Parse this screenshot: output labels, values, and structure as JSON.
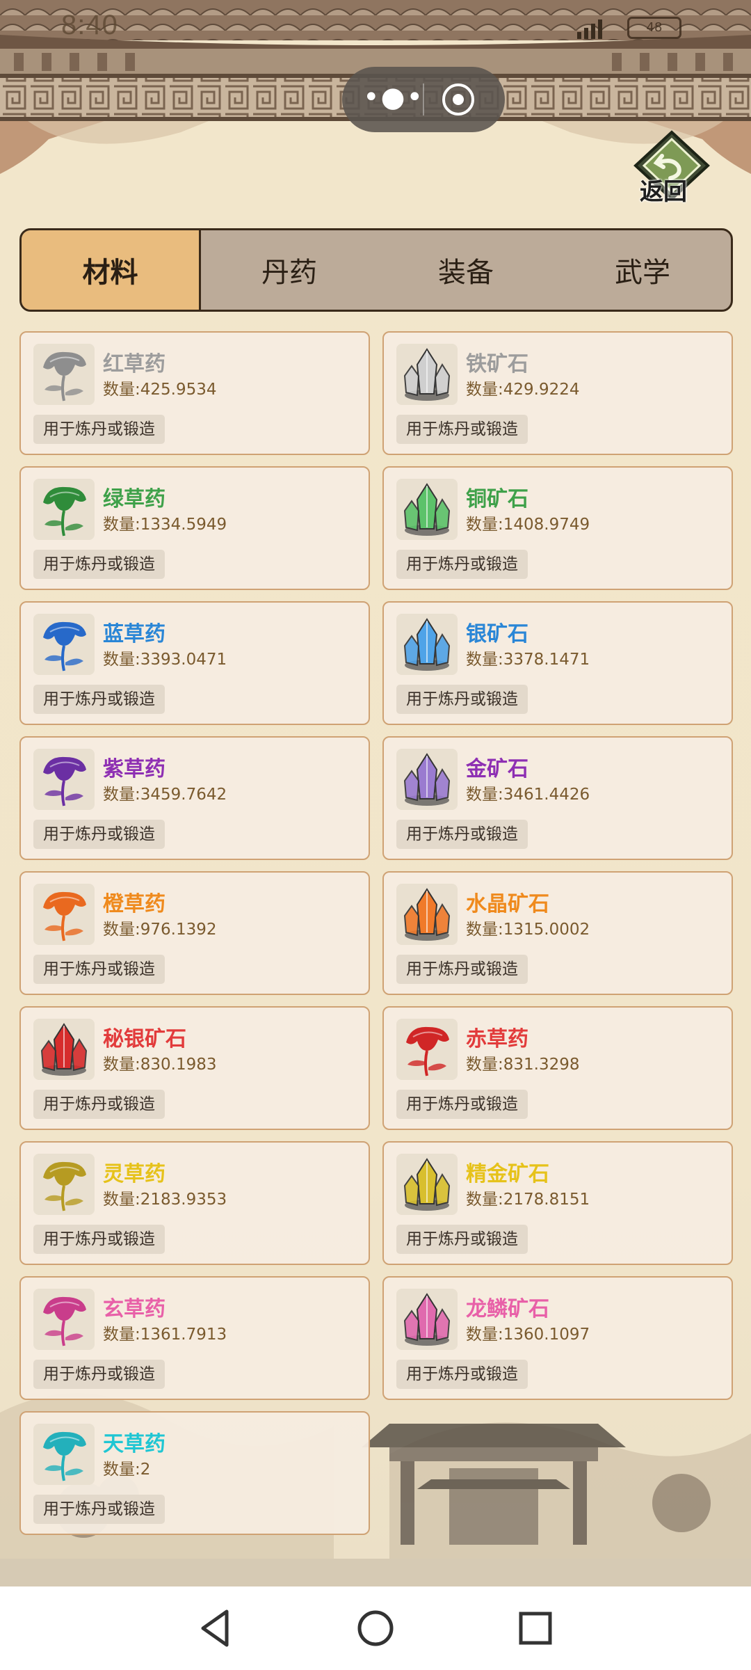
{
  "status": {
    "time": "8:40",
    "battery": "48"
  },
  "header": {
    "back_label": "返回"
  },
  "tabs": [
    {
      "label": "材料",
      "active": true
    },
    {
      "label": "丹药",
      "active": false
    },
    {
      "label": "装备",
      "active": false
    },
    {
      "label": "武学",
      "active": false
    }
  ],
  "items": [
    {
      "name": "红草药",
      "qty": "数量:425.9534",
      "desc": "用于炼丹或锻造",
      "color": "#9c9c9c",
      "icon": "herb-icon",
      "tint": "#8e8e8e"
    },
    {
      "name": "铁矿石",
      "qty": "数量:429.9224",
      "desc": "用于炼丹或锻造",
      "color": "#9c9c9c",
      "icon": "crystal-icon",
      "tint": "#cfcfcf"
    },
    {
      "name": "绿草药",
      "qty": "数量:1334.5949",
      "desc": "用于炼丹或锻造",
      "color": "#3fa14a",
      "icon": "herb-icon",
      "tint": "#2f8c3a"
    },
    {
      "name": "铜矿石",
      "qty": "数量:1408.9749",
      "desc": "用于炼丹或锻造",
      "color": "#3fa14a",
      "icon": "crystal-icon",
      "tint": "#5cc26a"
    },
    {
      "name": "蓝草药",
      "qty": "数量:3393.0471",
      "desc": "用于炼丹或锻造",
      "color": "#2a86d6",
      "icon": "herb-icon",
      "tint": "#2769c9"
    },
    {
      "name": "银矿石",
      "qty": "数量:3378.1471",
      "desc": "用于炼丹或锻造",
      "color": "#2a86d6",
      "icon": "crystal-icon",
      "tint": "#4fa3e8"
    },
    {
      "name": "紫草药",
      "qty": "数量:3459.7642",
      "desc": "用于炼丹或锻造",
      "color": "#8e2fb3",
      "icon": "herb-icon",
      "tint": "#6b2fa3"
    },
    {
      "name": "金矿石",
      "qty": "数量:3461.4426",
      "desc": "用于炼丹或锻造",
      "color": "#8e2fb3",
      "icon": "crystal-icon",
      "tint": "#9a7bd0"
    },
    {
      "name": "橙草药",
      "qty": "数量:976.1392",
      "desc": "用于炼丹或锻造",
      "color": "#ef8a1d",
      "icon": "herb-icon",
      "tint": "#e9691f"
    },
    {
      "name": "水晶矿石",
      "qty": "数量:1315.0002",
      "desc": "用于炼丹或锻造",
      "color": "#ef8a1d",
      "icon": "crystal-icon",
      "tint": "#f07a2a"
    },
    {
      "name": "秘银矿石",
      "qty": "数量:830.1983",
      "desc": "用于炼丹或锻造",
      "color": "#e23b3b",
      "icon": "crystal-icon",
      "tint": "#d62c2c"
    },
    {
      "name": "赤草药",
      "qty": "数量:831.3298",
      "desc": "用于炼丹或锻造",
      "color": "#e23b3b",
      "icon": "herb-icon",
      "tint": "#d02626"
    },
    {
      "name": "灵草药",
      "qty": "数量:2183.9353",
      "desc": "用于炼丹或锻造",
      "color": "#e6c21a",
      "icon": "herb-icon",
      "tint": "#b69b22"
    },
    {
      "name": "精金矿石",
      "qty": "数量:2178.8151",
      "desc": "用于炼丹或锻造",
      "color": "#e6c21a",
      "icon": "crystal-icon",
      "tint": "#d8bf2e"
    },
    {
      "name": "玄草药",
      "qty": "数量:1361.7913",
      "desc": "用于炼丹或锻造",
      "color": "#e860a8",
      "icon": "herb-icon",
      "tint": "#c93d8b"
    },
    {
      "name": "龙鳞矿石",
      "qty": "数量:1360.1097",
      "desc": "用于炼丹或锻造",
      "color": "#e860a8",
      "icon": "crystal-icon",
      "tint": "#e06aae"
    },
    {
      "name": "天草药",
      "qty": "数量:2",
      "desc": "用于炼丹或锻造",
      "color": "#1fc6d3",
      "icon": "herb-icon",
      "tint": "#23b0bb"
    }
  ]
}
